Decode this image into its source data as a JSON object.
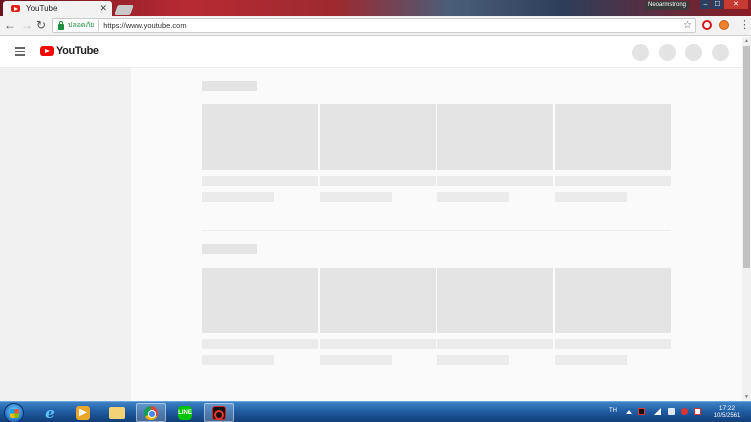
{
  "browser": {
    "tab_title": "YouTube",
    "tab_close": "✕",
    "profile_name": "Neoarmstrong",
    "window_controls": {
      "minimize": "–",
      "maximize": "☐",
      "close": "✕"
    },
    "nav": {
      "back": "←",
      "forward": "→",
      "reload": "↻"
    },
    "security_label": "ปลอดภัย",
    "url": "https://www.youtube.com",
    "bookmark_star": "☆",
    "menu": "⋮",
    "extensions": [
      "opera-icon",
      "orange-extension-icon"
    ]
  },
  "youtube": {
    "logo_text": "YouTube",
    "logo_color": "#ff0000",
    "placeholder_color": "#e4e4e4",
    "sidebar_color": "#f1f1f1"
  },
  "scrollbar": {
    "up": "▲",
    "down": "▼"
  },
  "taskbar": {
    "apps": [
      {
        "name": "internet-explorer-icon",
        "glyph": "e"
      },
      {
        "name": "windows-media-player-icon",
        "glyph": "▶"
      },
      {
        "name": "file-explorer-icon",
        "glyph": ""
      },
      {
        "name": "chrome-icon",
        "glyph": "",
        "active": true
      },
      {
        "name": "line-icon",
        "glyph": "LINE"
      },
      {
        "name": "garena-icon",
        "glyph": ""
      }
    ],
    "language": "TH",
    "time": "17:22",
    "date": "10/5/2561"
  }
}
